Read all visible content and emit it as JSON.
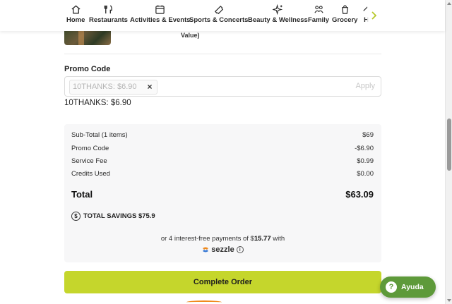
{
  "nav": {
    "items": [
      {
        "label": "Home",
        "icon": "home-icon"
      },
      {
        "label": "Restaurants",
        "icon": "fork-knife-icon"
      },
      {
        "label": "Activities & Events",
        "icon": "calendar-icon"
      },
      {
        "label": "Sports & Concerts",
        "icon": "ticket-icon"
      },
      {
        "label": "Beauty & Wellness",
        "icon": "sparkles-icon"
      },
      {
        "label": "Family",
        "icon": "family-icon"
      },
      {
        "label": "Grocery",
        "icon": "grocery-icon"
      },
      {
        "label": "H",
        "icon": "cut-off-icon"
      }
    ],
    "next_icon": "chevron-right-icon"
  },
  "item": {
    "value_text": "Value)"
  },
  "promo": {
    "label": "Promo Code",
    "chip_text": "10THANKS: $6.90",
    "apply_label": "Apply",
    "applied_text": "10THANKS: $6.90"
  },
  "summary": {
    "rows": [
      {
        "label": "Sub-Total (1 items)",
        "value": "$69"
      },
      {
        "label": "Promo Code",
        "value": "-$6.90"
      },
      {
        "label": "Service Fee",
        "value": "$0.99"
      },
      {
        "label": "Credits Used",
        "value": "$0.00"
      }
    ],
    "total_label": "Total",
    "total_value": "$63.09",
    "savings_text": "TOTAL SAVINGS $75.9",
    "sezzle_prefix": "or 4 interest-free payments of $",
    "sezzle_amount": "15.77",
    "sezzle_suffix": " with",
    "sezzle_brand": "sezzle"
  },
  "actions": {
    "complete_label": "Complete Order"
  },
  "help": {
    "label": "Ayuda"
  },
  "colors": {
    "accent": "#c5d62c",
    "help_green": "#5e9a3a",
    "sezzle_orange": "#f08a1c"
  }
}
